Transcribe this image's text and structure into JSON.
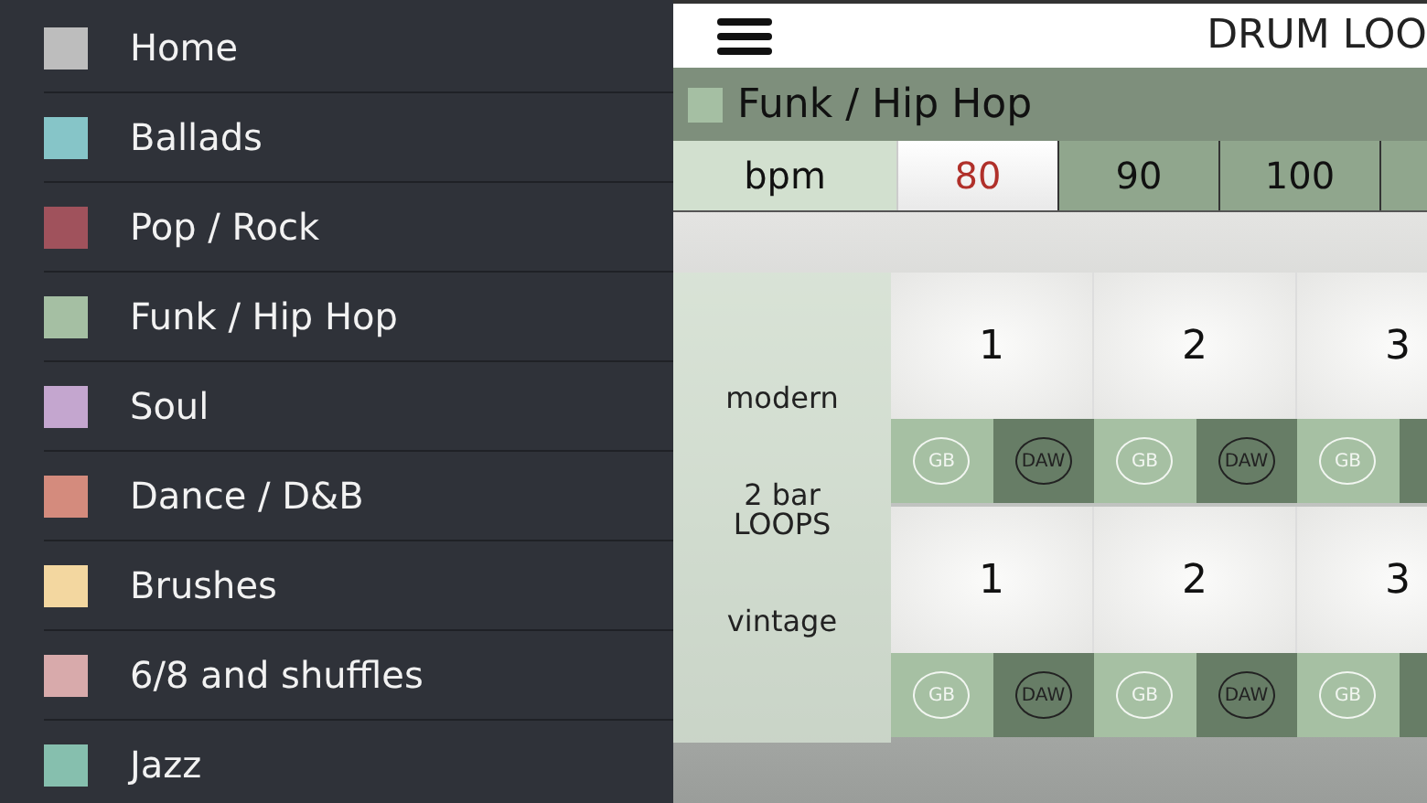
{
  "sidebar": {
    "items": [
      {
        "label": "Home",
        "color": "#bdbdbd"
      },
      {
        "label": "Ballads",
        "color": "#86c5c8"
      },
      {
        "label": "Pop / Rock",
        "color": "#a0525c"
      },
      {
        "label": "Funk / Hip Hop",
        "color": "#a5bfa3"
      },
      {
        "label": "Soul",
        "color": "#c4a6cf"
      },
      {
        "label": "Dance / D&B",
        "color": "#d48b7d"
      },
      {
        "label": "Brushes",
        "color": "#f3d7a0"
      },
      {
        "label": "6/8 and shuffles",
        "color": "#d8aaab"
      },
      {
        "label": "Jazz",
        "color": "#86bfae"
      }
    ]
  },
  "header": {
    "title": "DRUM LOO"
  },
  "category": {
    "label": "Funk / Hip Hop",
    "color": "#a5bfa3"
  },
  "bpm": {
    "label": "bpm",
    "options": [
      {
        "label": "80",
        "selected": true
      },
      {
        "label": "90",
        "selected": false
      },
      {
        "label": "100",
        "selected": false
      }
    ]
  },
  "loops": {
    "labels": [
      "modern",
      "2 bar LOOPS",
      "vintage"
    ],
    "rows": [
      {
        "cells": [
          {
            "number": "1",
            "buttons": [
              "GB",
              "DAW"
            ]
          },
          {
            "number": "2",
            "buttons": [
              "GB",
              "DAW"
            ]
          },
          {
            "number": "3",
            "buttons": [
              "GB"
            ]
          }
        ]
      },
      {
        "cells": [
          {
            "number": "1",
            "buttons": [
              "GB",
              "DAW"
            ]
          },
          {
            "number": "2",
            "buttons": [
              "GB",
              "DAW"
            ]
          },
          {
            "number": "3",
            "buttons": [
              "GB"
            ]
          }
        ]
      }
    ]
  }
}
